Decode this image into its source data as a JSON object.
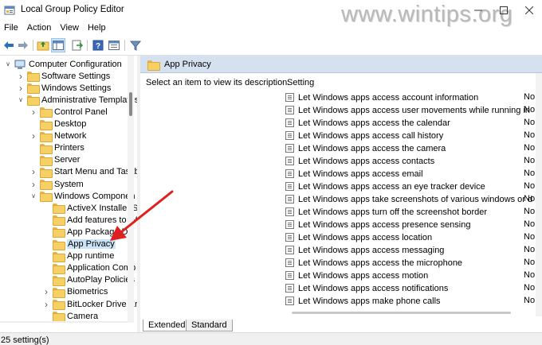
{
  "window": {
    "title": "Local Group Policy Editor",
    "watermark": "www.wintips.org",
    "controls": [
      "minimize",
      "maximize",
      "close"
    ]
  },
  "menu": [
    "File",
    "Action",
    "View",
    "Help"
  ],
  "toolbar": [
    "back-icon",
    "forward-icon",
    "up-folder-icon",
    "show-hide-tree-icon",
    "export-list-icon",
    "help-icon",
    "properties-icon",
    "filter-icon"
  ],
  "tree": {
    "items": [
      {
        "label": "Computer Configuration",
        "expander": "open",
        "indent": 0
      },
      {
        "label": "Software Settings",
        "expander": "closed",
        "indent": 1
      },
      {
        "label": "Windows Settings",
        "expander": "closed",
        "indent": 1
      },
      {
        "label": "Administrative Templates",
        "expander": "open",
        "indent": 1
      },
      {
        "label": "Control Panel",
        "expander": "closed",
        "indent": 2
      },
      {
        "label": "Desktop",
        "expander": "none",
        "indent": 2
      },
      {
        "label": "Network",
        "expander": "closed",
        "indent": 2
      },
      {
        "label": "Printers",
        "expander": "none",
        "indent": 2
      },
      {
        "label": "Server",
        "expander": "none",
        "indent": 2
      },
      {
        "label": "Start Menu and Taskb",
        "expander": "closed",
        "indent": 2
      },
      {
        "label": "System",
        "expander": "closed",
        "indent": 2
      },
      {
        "label": "Windows Componen",
        "expander": "open",
        "indent": 2
      },
      {
        "label": "ActiveX Installer S",
        "expander": "none",
        "indent": 3
      },
      {
        "label": "Add features to W",
        "expander": "none",
        "indent": 3
      },
      {
        "label": "App Package D",
        "expander": "none",
        "indent": 3
      },
      {
        "label": "App Privacy",
        "expander": "none",
        "indent": 3,
        "selected": true
      },
      {
        "label": "App runtime",
        "expander": "none",
        "indent": 3
      },
      {
        "label": "Application Comp",
        "expander": "none",
        "indent": 3
      },
      {
        "label": "AutoPlay Policies",
        "expander": "none",
        "indent": 3
      },
      {
        "label": "Biometrics",
        "expander": "closed",
        "indent": 3
      },
      {
        "label": "BitLocker Drive Er",
        "expander": "closed",
        "indent": 3
      },
      {
        "label": "Camera",
        "expander": "none",
        "indent": 3
      }
    ]
  },
  "details": {
    "header_title": "App Privacy",
    "description": "Select an item to view its description.",
    "column_setting": "Setting",
    "settings": [
      {
        "name": "Let Windows apps access account information",
        "state": "Not configured"
      },
      {
        "name": "Let Windows apps access user movements while running in t...",
        "state": "Not configured"
      },
      {
        "name": "Let Windows apps access the calendar",
        "state": "Not configured"
      },
      {
        "name": "Let Windows apps access call history",
        "state": "Not configured"
      },
      {
        "name": "Let Windows apps access the camera",
        "state": "Not configured"
      },
      {
        "name": "Let Windows apps access contacts",
        "state": "Not configured"
      },
      {
        "name": "Let Windows apps access email",
        "state": "Not configured"
      },
      {
        "name": "Let Windows apps access an eye tracker device",
        "state": "Not configured"
      },
      {
        "name": "Let Windows apps take screenshots of various windows or dis...",
        "state": "Not configured"
      },
      {
        "name": "Let Windows apps turn off the screenshot border",
        "state": "Not configured"
      },
      {
        "name": "Let Windows apps access presence sensing",
        "state": "Not configured"
      },
      {
        "name": "Let Windows apps access location",
        "state": "Not configured"
      },
      {
        "name": "Let Windows apps access messaging",
        "state": "Not configured"
      },
      {
        "name": "Let Windows apps access the microphone",
        "state": "Not configured"
      },
      {
        "name": "Let Windows apps access motion",
        "state": "Not configured"
      },
      {
        "name": "Let Windows apps access notifications",
        "state": "Not configured"
      },
      {
        "name": "Let Windows apps make phone calls",
        "state": "Not configured"
      }
    ],
    "tabs": [
      "Extended",
      "Standard"
    ]
  },
  "status": {
    "text": "25 setting(s)"
  },
  "colors": {
    "header_bg": "#d6e1ef",
    "selection": "#cce4f7",
    "annotation_arrow": "#e02020",
    "folder": "#f6cf65"
  }
}
